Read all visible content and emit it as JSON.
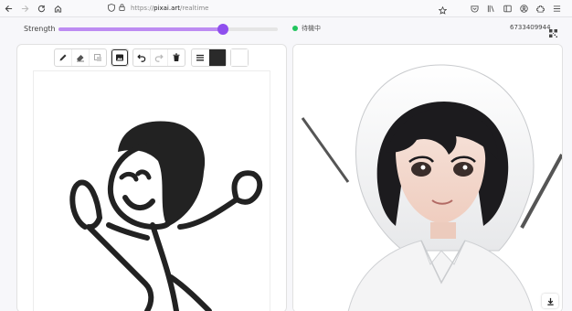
{
  "browser": {
    "url_prefix": "https://",
    "url_domain": "pixai.art",
    "url_path": "/realtime",
    "icons": [
      "back-icon",
      "forward-icon",
      "reload-icon",
      "home-icon",
      "shield-icon",
      "lock-icon",
      "star-icon",
      "pocket-icon",
      "library-icon",
      "sidebar-icon",
      "account-icon",
      "extensions-icon",
      "menu-icon"
    ]
  },
  "controls": {
    "strength_label": "Strength",
    "strength_value": 0.75,
    "accent": "#8f4fee",
    "status_text": "待機中",
    "status_color": "#22c55e",
    "session_id": "6733409944"
  },
  "toolbar": {
    "tools": [
      "pencil-icon",
      "eraser-icon",
      "fill-icon",
      "image-icon",
      "undo-icon",
      "redo-icon",
      "trash-icon",
      "line-width-icon",
      "color-black",
      "color-white"
    ],
    "colors": [
      "#2a2a2a",
      "#ffffff"
    ]
  },
  "output": {
    "download_icon": "download-icon"
  }
}
